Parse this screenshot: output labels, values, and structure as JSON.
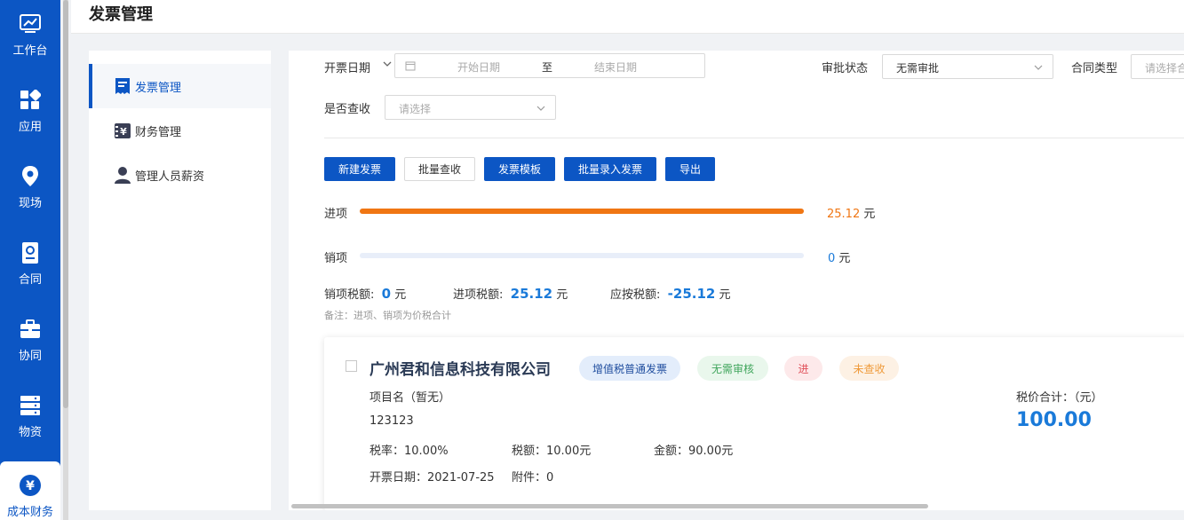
{
  "header": {
    "title": "发票管理"
  },
  "rail": [
    {
      "label": "工作台",
      "icon": "chart-icon"
    },
    {
      "label": "应用",
      "icon": "apps-icon"
    },
    {
      "label": "现场",
      "icon": "location-icon"
    },
    {
      "label": "合同",
      "icon": "contract-icon"
    },
    {
      "label": "协同",
      "icon": "briefcase-icon"
    },
    {
      "label": "物资",
      "icon": "storage-icon"
    },
    {
      "label": "成本财务",
      "icon": "yen-icon"
    }
  ],
  "subnav": [
    {
      "label": "发票管理",
      "icon": "invoice-icon"
    },
    {
      "label": "财务管理",
      "icon": "finance-icon"
    },
    {
      "label": "管理人员薪资",
      "icon": "person-icon"
    }
  ],
  "filters": {
    "invoice_date_label": "开票日期",
    "start_placeholder": "开始日期",
    "range_sep": "至",
    "end_placeholder": "结束日期",
    "approval_label": "审批状态",
    "approval_value": "无需审批",
    "contract_type_label": "合同类型",
    "contract_type_placeholder": "请选择合",
    "checked_label": "是否查收",
    "checked_placeholder": "请选择"
  },
  "toolbar": {
    "new_invoice": "新建发票",
    "batch_check": "批量查收",
    "template": "发票模板",
    "batch_import": "批量录入发票",
    "export": "导出"
  },
  "stats": {
    "input_label": "进项",
    "input_amount": "25.12",
    "input_ratio": 1.0,
    "output_label": "销项",
    "output_amount": "0",
    "output_ratio": 0,
    "unit": "元",
    "output_tax_label": "销项税额:",
    "output_tax_value": "0",
    "input_tax_label": "进项税额:",
    "input_tax_value": "25.12",
    "payable_tax_label": "应按税额:",
    "payable_tax_value": "-25.12",
    "note": "备注：进项、销项为价税合计"
  },
  "invoice_card": {
    "company": "广州君和信息科技有限公司",
    "tags": [
      "增值税普通发票",
      "无需审核",
      "进",
      "未查收"
    ],
    "project_name": "项目名（暂无）",
    "number": "123123",
    "tax_rate": "税率：10.00%",
    "tax_amount": "税额：10.00元",
    "amount": "金额：90.00元",
    "issue_date": "开票日期：2021-07-25",
    "attachments": "附件：0",
    "total_label": "税价合计：（元）",
    "total_value": "100.00"
  },
  "colors": {
    "brand": "#0c56c4",
    "accent_blue": "#1a7ad9",
    "input_bar": "#f07613"
  }
}
